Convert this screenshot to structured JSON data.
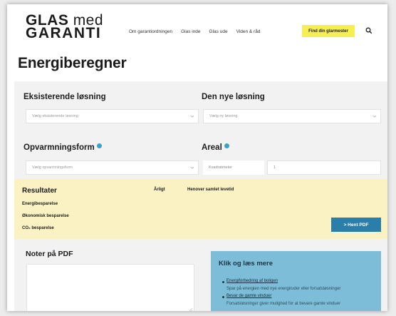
{
  "header": {
    "logo_line1_bold": "GLAS",
    "logo_line1_light": "med",
    "logo_line2": "GARANTI",
    "nav": [
      "Om garantiordningen",
      "Glas inde",
      "Glas ude",
      "Viden & råd"
    ],
    "cta_label": "Find din glarmester",
    "search_icon": "search-icon"
  },
  "page_title": "Energiberegner",
  "existing": {
    "title": "Eksisterende løsning",
    "placeholder": "Vælg eksisterende løsning"
  },
  "new": {
    "title": "Den nye løsning",
    "placeholder": "Vælg ny løsning"
  },
  "heating": {
    "title": "Opvarmningsform",
    "placeholder": "Vælg opvarmningsform"
  },
  "area": {
    "title": "Areal",
    "label": "Kvadratmeter",
    "value": "1"
  },
  "results": {
    "title": "Resultater",
    "col_yearly": "Årligt",
    "col_lifetime": "Henover samlet levetid",
    "rows": [
      "Energibesparelse",
      "Økonomisk besparelse",
      "CO₂ besparelse"
    ],
    "pdf_button": "> Hent PDF"
  },
  "notes": {
    "title": "Noter på PDF"
  },
  "read_more": {
    "title": "Klik og læs mere",
    "items": [
      {
        "link": "Energiforbedring af boligen",
        "desc": "Spar på energien med nye energiruder eller forsatsløsninger"
      },
      {
        "link": "Bevar de gamle vinduer",
        "desc": "Forsatsløsninger giver mulighed for at bevare gamle vinduer"
      }
    ]
  },
  "colors": {
    "yellow_panel": "#fbf2c4",
    "cta": "#f6ef52",
    "blue_button": "#2b7ea7",
    "info_panel": "#7dbdd7"
  }
}
